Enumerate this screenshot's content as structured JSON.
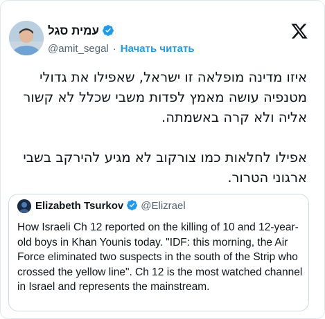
{
  "author": {
    "display_name": "עמית סגל",
    "handle": "@amit_segal",
    "separator": "·",
    "follow_label": "Начать читать",
    "avatar": "avatar-photo",
    "verified_icon": "verified-badge-icon"
  },
  "brand": {
    "icon": "x-logo-icon"
  },
  "tweet": {
    "paragraphs": [
      "איזו מדינה מופלאה זו ישראל, שאפילו את גדולי מטנפיה עושה מאמץ לפדות משבי שכלל לא קשור אליה ולא קרה באשמתה.",
      "אפילו לחלאות כמו צורקוב לא מגיע להירקב בשבי ארגוני הטרור."
    ]
  },
  "quoted_tweet": {
    "display_name": "Elizabeth Tsurkov",
    "handle": "@Elizrael",
    "text": "How Israeli Ch 12 reported on the killing of 10 and 12-year-old boys in Khan Younis today. \"IDF: this morning, the Air Force eliminated two suspects in the south of the Strip who crossed the yellow line\". Ch 12 is the most watched channel in Israel and represents the mainstream."
  },
  "colors": {
    "accent": "#1d9bf0",
    "text": "#0f1419",
    "muted": "#536471",
    "border": "#cfd9de"
  }
}
